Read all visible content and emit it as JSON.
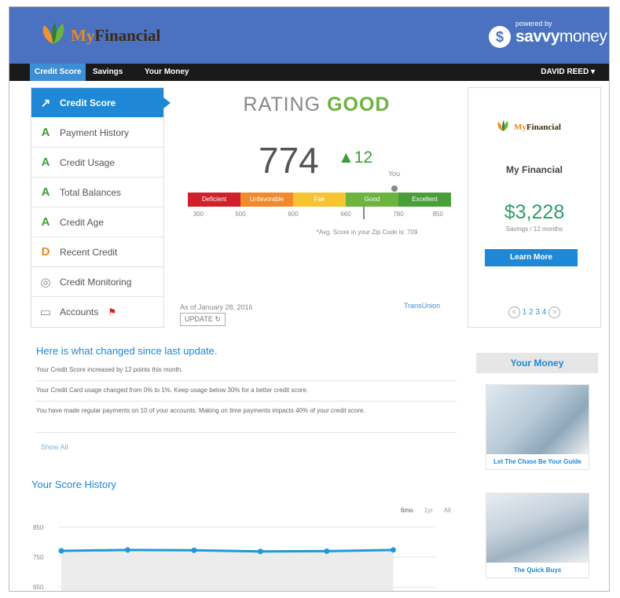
{
  "brand": {
    "name_prefix": "My",
    "name_suffix": "Financial"
  },
  "powered_by": {
    "label": "powered by",
    "savvy": "savvy",
    "money": "money",
    "icon_glyph": "$"
  },
  "nav": {
    "credit_score": "Credit Score",
    "savings": "Savings",
    "your_money": "Your Money",
    "user": "DAVID REED ▾"
  },
  "sidebar": {
    "items": [
      {
        "label": "Credit Score",
        "glyph": "↗"
      },
      {
        "label": "Payment History",
        "glyph": "A"
      },
      {
        "label": "Credit Usage",
        "glyph": "A"
      },
      {
        "label": "Total Balances",
        "glyph": "A"
      },
      {
        "label": "Credit Age",
        "glyph": "A"
      },
      {
        "label": "Recent Credit",
        "glyph": "D"
      },
      {
        "label": "Credit Monitoring",
        "glyph": "◎"
      },
      {
        "label": "Accounts",
        "glyph": "▭",
        "flag": "⚑"
      }
    ]
  },
  "rating": {
    "prefix": "RATING",
    "value": "GOOD"
  },
  "score": {
    "value": "774",
    "delta": "▲12",
    "you_label": "You"
  },
  "scale": {
    "bands": [
      "Deficient",
      "Unfavorable",
      "Fair",
      "Good",
      "Excellent"
    ],
    "band_colors": [
      "#d0202a",
      "#f08a2a",
      "#f5c430",
      "#6cb33f",
      "#4a9e3a"
    ],
    "ticks": [
      "300",
      "500",
      "600",
      "660",
      "780",
      "850"
    ],
    "avg_note": "*Avg. Score in your Zip Code is: 709"
  },
  "as_of": "As of January 28, 2016",
  "update_label": "UPDATE",
  "update_icon": "↻",
  "bureau": "TransUnion",
  "promo": {
    "brand_prefix": "My",
    "brand_suffix": "Financial",
    "title": "My Financial",
    "amount": "$3,228",
    "sub": "Savings / 12 months",
    "button": "Learn More",
    "pager": {
      "prev": "<",
      "pages": "1 2 3 4",
      "next": ">"
    }
  },
  "changes": {
    "title": "Here is what changed since last update.",
    "rows": [
      "Your Credit Score increased by 12 points this month.",
      "Your Credit Card usage changed from 0% to 1%. Keep usage below 30% for a better credit score.",
      "You have made regular payments on 10 of your accounts. Making on time payments impacts 40% of your credit score."
    ],
    "show_all": "Show All"
  },
  "history": {
    "title": "Your Score History",
    "ranges": [
      "6mo",
      "1yr",
      "All"
    ]
  },
  "chart_data": {
    "type": "line",
    "series": [
      {
        "values": [
          771,
          774,
          773,
          769,
          770,
          774
        ]
      }
    ],
    "yticks": [
      "850",
      "750",
      "650"
    ],
    "ylim": [
      640,
      860
    ],
    "grid": true,
    "color": "#1e9ad6"
  },
  "your_money": {
    "title": "Your Money",
    "cards": [
      {
        "caption": "Let The Chase Be Your Guide"
      },
      {
        "caption": "The Quick Buys"
      }
    ]
  }
}
